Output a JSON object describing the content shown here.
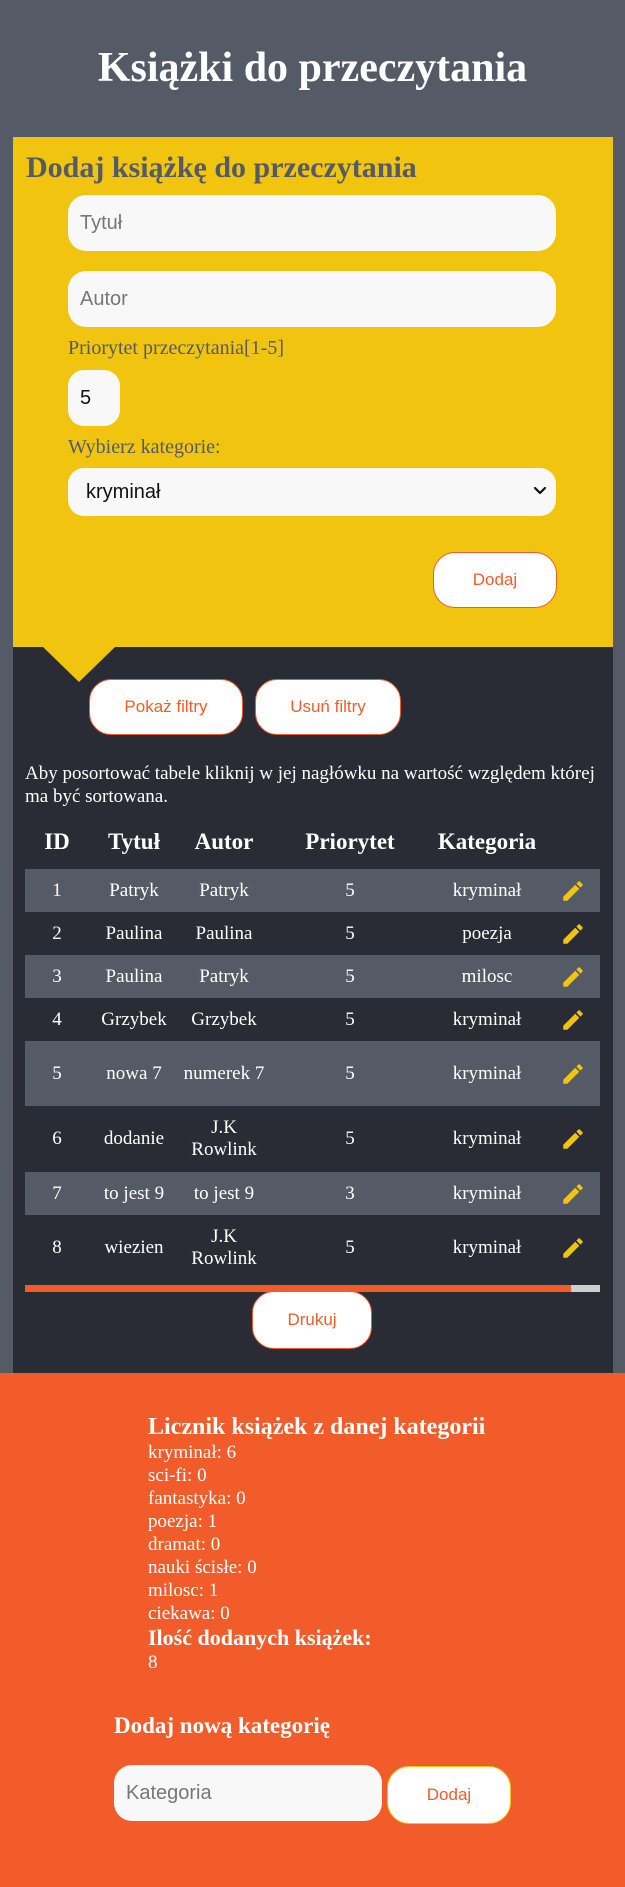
{
  "header": {
    "title": "Książki do przeczytania"
  },
  "add_form": {
    "title": "Dodaj książkę do przeczytania",
    "title_placeholder": "Tytuł",
    "author_placeholder": "Autor",
    "priority_label": "Priorytet przeczytania[1-5]",
    "priority_value": "5",
    "category_label": "Wybierz kategorie:",
    "category_selected": "kryminał",
    "submit_label": "Dodaj"
  },
  "filters": {
    "show_label": "Pokaż filtry",
    "clear_label": "Usuń filtry"
  },
  "hint": "Aby posortować tabele kliknij w jej nagłówku na wartość względem której ma być sortowana.",
  "table": {
    "headers": {
      "id": "ID",
      "title": "Tytuł",
      "author": "Autor",
      "priority": "Priorytet",
      "category": "Kategoria"
    },
    "rows": [
      {
        "id": "1",
        "title": "Patryk",
        "author": "Patryk",
        "priority": "5",
        "category": "kryminał"
      },
      {
        "id": "2",
        "title": "Paulina",
        "author": "Paulina",
        "priority": "5",
        "category": "poezja"
      },
      {
        "id": "3",
        "title": "Paulina",
        "author": "Patryk",
        "priority": "5",
        "category": "milosc"
      },
      {
        "id": "4",
        "title": "Grzybek",
        "author": "Grzybek",
        "priority": "5",
        "category": "kryminał"
      },
      {
        "id": "5",
        "title": "nowa 7",
        "author": "numerek 7",
        "priority": "5",
        "category": "kryminał"
      },
      {
        "id": "6",
        "title": "dodanie",
        "author": "J.K Rowlink",
        "priority": "5",
        "category": "kryminał"
      },
      {
        "id": "7",
        "title": "to jest 9",
        "author": "to jest 9",
        "priority": "3",
        "category": "kryminał"
      },
      {
        "id": "8",
        "title": "wiezien",
        "author": "J.K Rowlink",
        "priority": "5",
        "category": "kryminał"
      }
    ]
  },
  "progress": {
    "value": 0.95,
    "fill_color": "#f25c2a"
  },
  "print_label": "Drukuj",
  "counter": {
    "title": "Licznik książek z danej kategorii",
    "lines": [
      "kryminał: 6",
      "sci-fi: 0",
      "fantastyka: 0",
      "poezja: 1",
      "dramat: 0",
      "nauki ścisłe: 0",
      "milosc: 1",
      "ciekawa: 0"
    ],
    "total_title": "Ilość dodanych książek:",
    "total_value": "8"
  },
  "new_category": {
    "title": "Dodaj nową kategorię",
    "placeholder": "Kategoria",
    "submit_label": "Dodaj"
  },
  "colors": {
    "yellow": "#f1c40f",
    "orange": "#f25c2a",
    "slate": "#545b66",
    "dark": "#292c34"
  },
  "icons": {
    "edit": "pencil-icon",
    "dropdown": "chevron-down-icon"
  }
}
